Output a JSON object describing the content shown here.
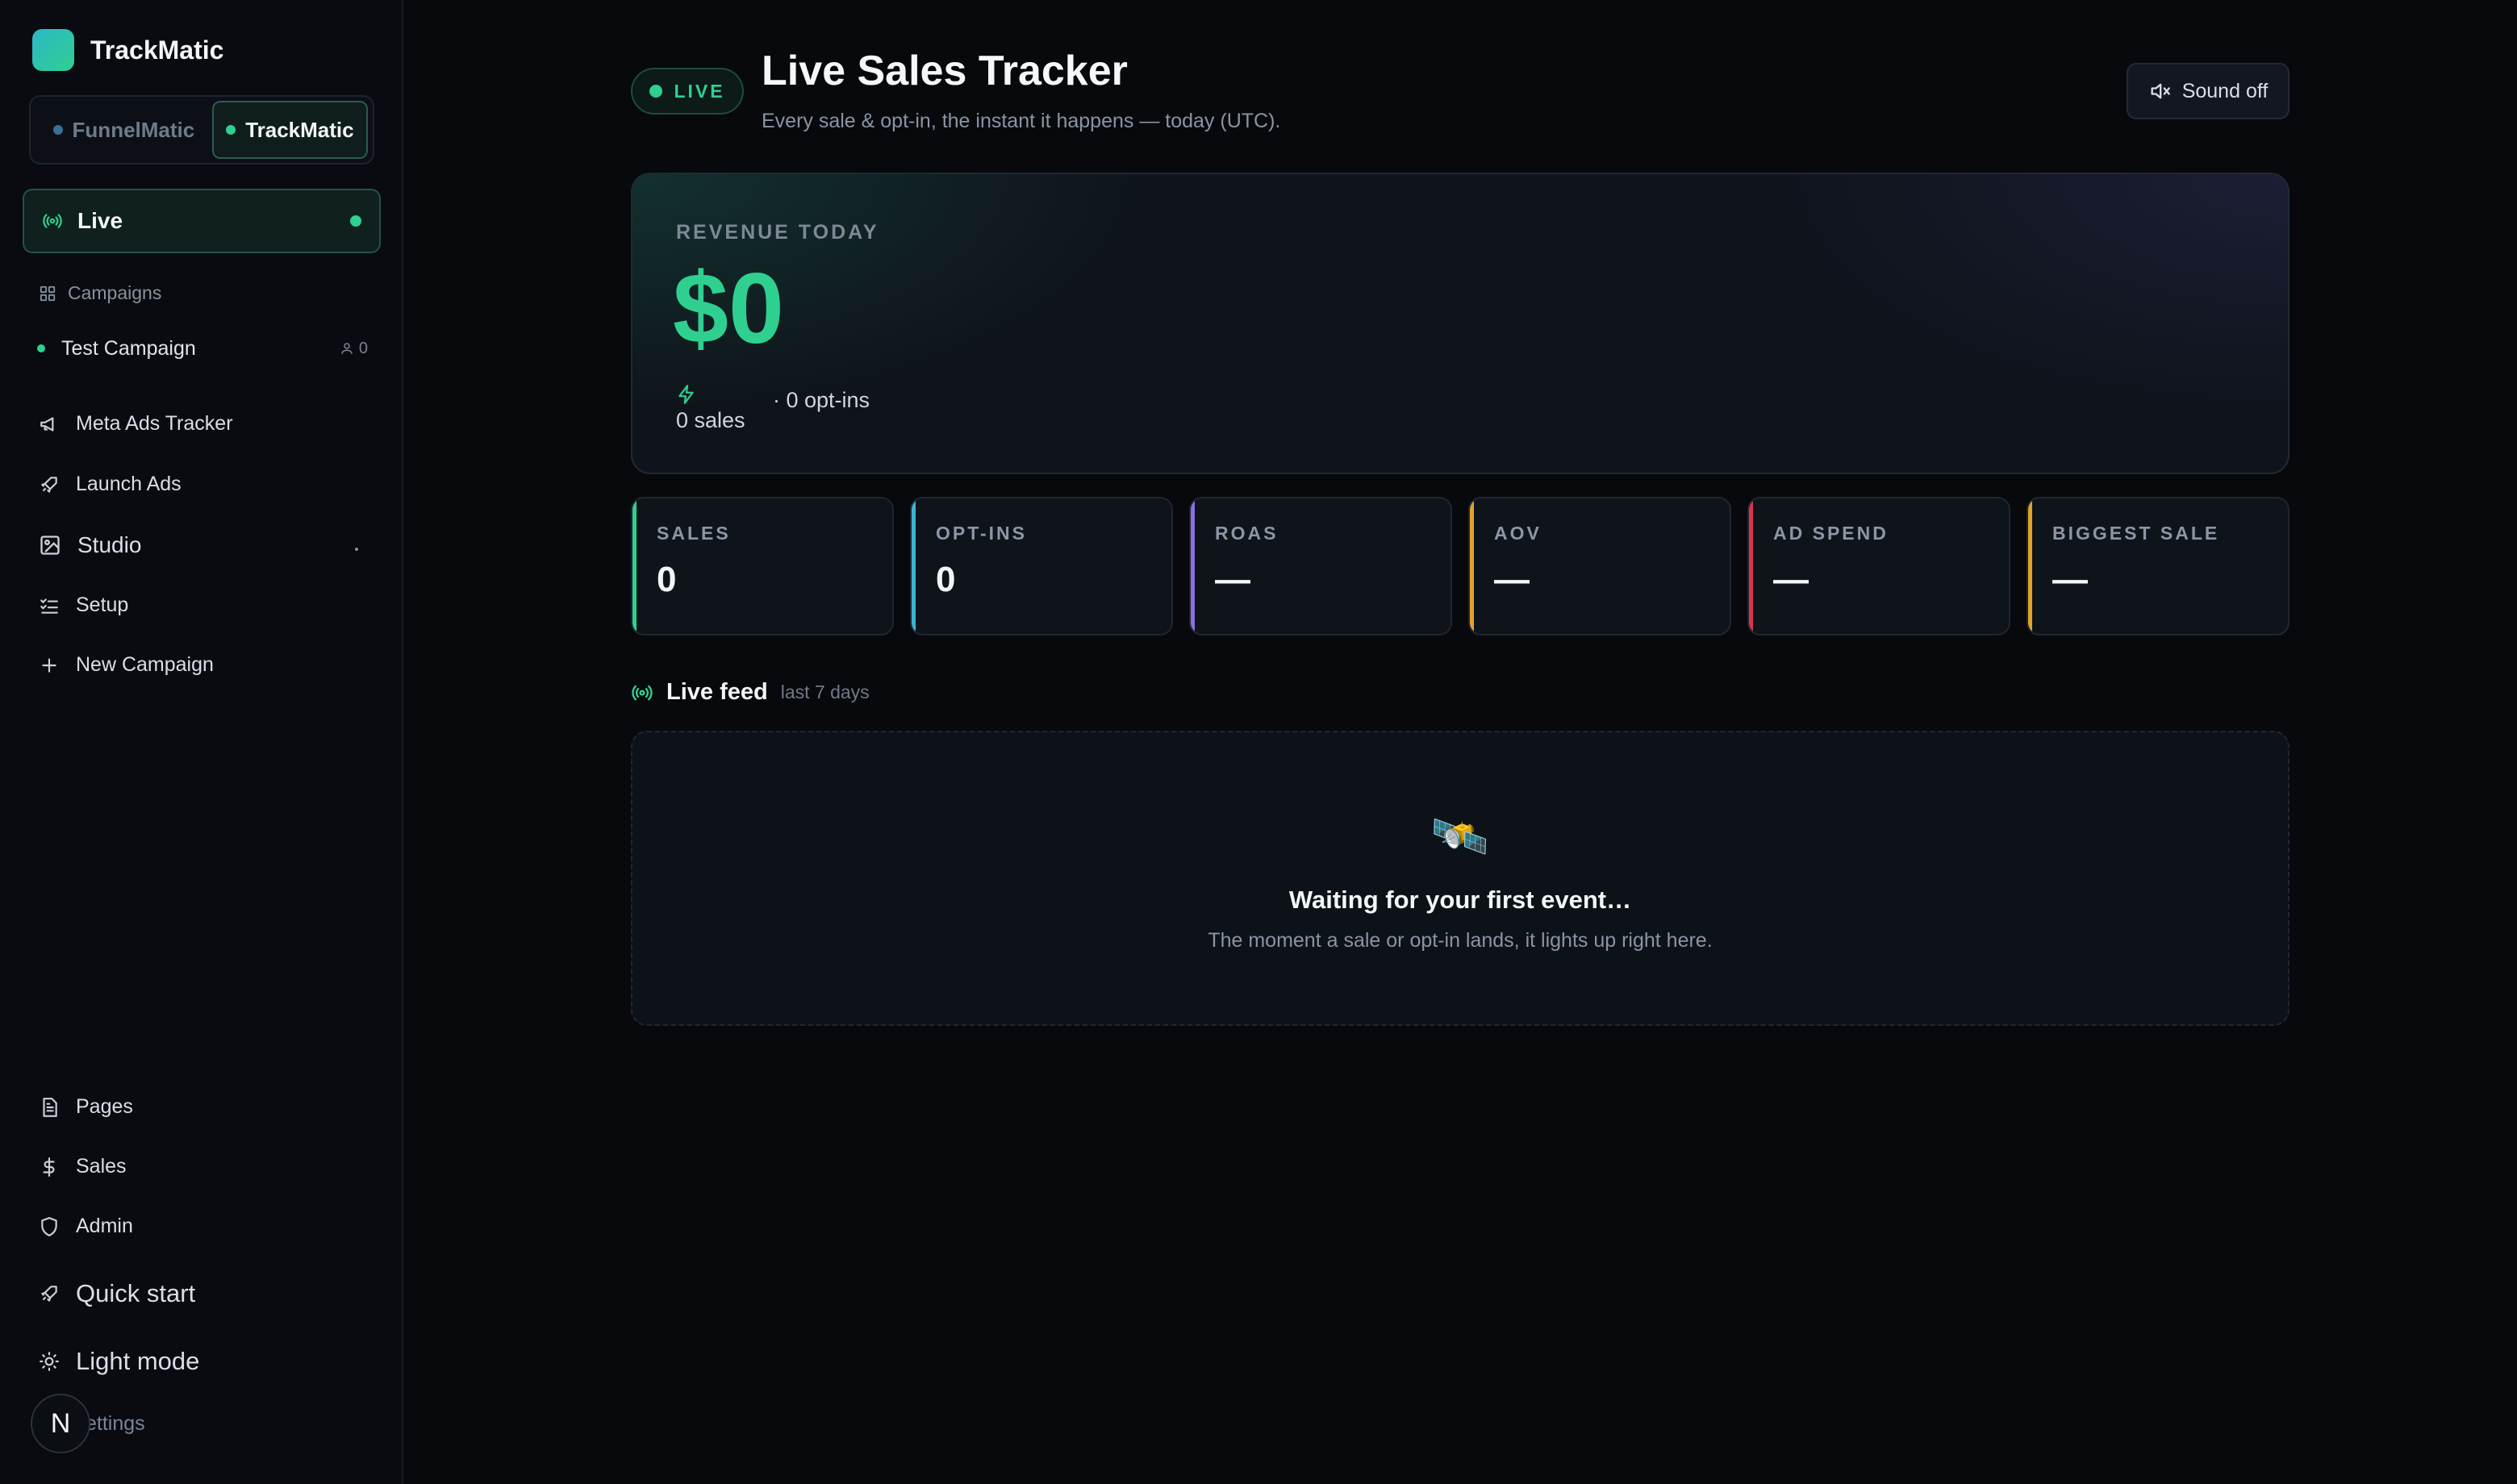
{
  "brand": {
    "name": "TrackMatic"
  },
  "switcher": {
    "funnel_label": "FunnelMatic",
    "track_label": "TrackMatic"
  },
  "nav": {
    "live_label": "Live",
    "campaigns_heading": "Campaigns",
    "campaigns": [
      {
        "name": "Test Campaign",
        "count": "0"
      }
    ],
    "items": [
      {
        "label": "Meta Ads Tracker",
        "icon": "megaphone-icon"
      },
      {
        "label": "Launch Ads",
        "icon": "rocket-icon"
      },
      {
        "label": "Studio",
        "icon": "image-edit-icon"
      },
      {
        "label": "Setup",
        "icon": "checklist-icon"
      },
      {
        "label": "New Campaign",
        "icon": "plus-icon"
      }
    ],
    "bottom": [
      {
        "label": "Pages",
        "icon": "document-icon"
      },
      {
        "label": "Sales",
        "icon": "dollar-icon"
      },
      {
        "label": "Admin",
        "icon": "shield-icon"
      },
      {
        "label": "Quick start",
        "icon": "rocket-icon"
      },
      {
        "label": "Light mode",
        "icon": "sun-icon"
      }
    ],
    "settings_label": "ettings",
    "avatar_letter": "N"
  },
  "header": {
    "live_badge": "LIVE",
    "title": "Live Sales Tracker",
    "subtitle": "Every sale & opt-in, the instant it happens — today (UTC).",
    "sound_label": "Sound off"
  },
  "revenue": {
    "label": "REVENUE TODAY",
    "value": "$0",
    "sales_text": "0 sales",
    "optins_text": "· 0 opt-ins"
  },
  "stats": [
    {
      "label": "SALES",
      "value": "0",
      "color": "#2fd08f"
    },
    {
      "label": "OPT-INS",
      "value": "0",
      "color": "#3bb4d6"
    },
    {
      "label": "ROAS",
      "value": "—",
      "color": "#8a6fe0"
    },
    {
      "label": "AOV",
      "value": "—",
      "color": "#e0a42a"
    },
    {
      "label": "AD SPEND",
      "value": "—",
      "color": "#d9344f"
    },
    {
      "label": "BIGGEST SALE",
      "value": "—",
      "color": "#e0a42a"
    }
  ],
  "feed": {
    "title": "Live feed",
    "range": "last 7 days",
    "empty_emoji": "🛰️",
    "empty_title": "Waiting for your first event…",
    "empty_text": "The moment a sale or opt-in lands, it lights up right here."
  },
  "colors": {
    "accent": "#2fd08f",
    "background": "#07090d",
    "card": "#0f141b"
  }
}
